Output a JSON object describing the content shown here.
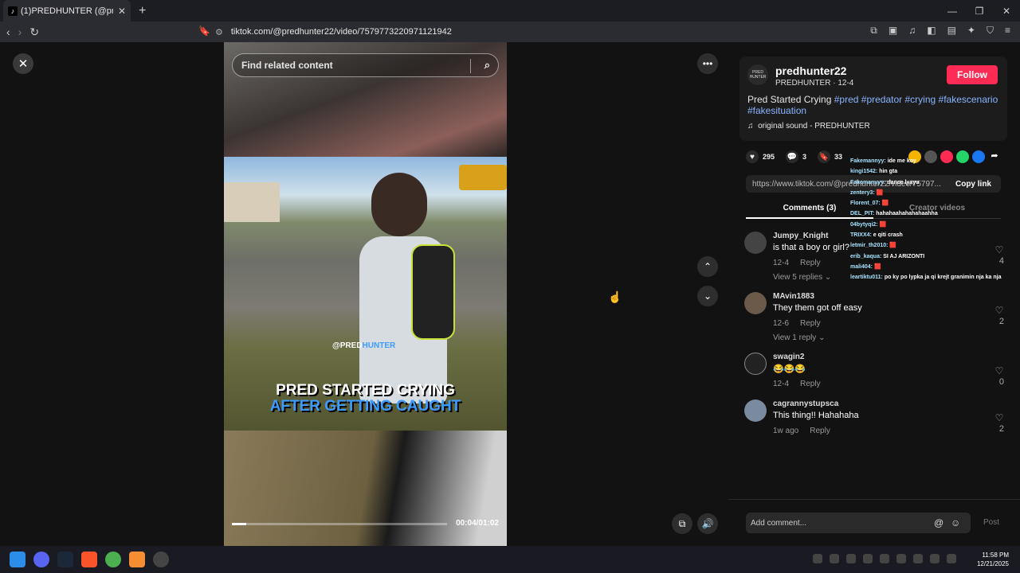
{
  "browser": {
    "tab_title": "(1)PREDHUNTER (@predhunt",
    "tab_favicon": "TikTok",
    "url": "tiktok.com/@predhunter22/video/7579773220971121942"
  },
  "player": {
    "search_placeholder": "Find related content",
    "time_display": "00:04/01:02",
    "progress_fraction": 0.065,
    "caption_line1": "PRED STARTED CRYING",
    "caption_line2": "AFTER GETTING CAUGHT",
    "watermark_prefix": "@PRED",
    "watermark_suffix": "HUNTER"
  },
  "author": {
    "username": "predhunter22",
    "nickname_date": "PREDHUNTER · 12-4",
    "follow_label": "Follow",
    "avatar_text": "PRED HUNTER",
    "description": "Pred Started Crying",
    "hashtags": [
      "#pred",
      "#predator",
      "#crying",
      "#fakescenario",
      "#fakesituation"
    ],
    "music": "original sound - PREDHUNTER"
  },
  "stats": {
    "likes": "295",
    "comments": "3",
    "saves": "33"
  },
  "link": {
    "url": "https://www.tiktok.com/@predhunter22/video/75797...",
    "copy_label": "Copy link"
  },
  "tabs": {
    "comments": "Comments (3)",
    "creator": "Creator videos"
  },
  "comments": [
    {
      "user": "Jumpy_Knight",
      "text": "is that a boy or girl?",
      "date": "12-4",
      "reply": "Reply",
      "likes": "4",
      "view_replies": "View 5 replies ⌄"
    },
    {
      "user": "MAvin1883",
      "text": "They them got off easy",
      "date": "12-6",
      "reply": "Reply",
      "likes": "2",
      "view_replies": "View 1 reply ⌄"
    },
    {
      "user": "swagin2",
      "text": "😂😂😂",
      "date": "12-4",
      "reply": "Reply",
      "likes": "0",
      "view_replies": ""
    },
    {
      "user": "cagrannystupsca",
      "text": "This thing!! Hahahaha",
      "date": "1w ago",
      "reply": "Reply",
      "likes": "2",
      "view_replies": ""
    }
  ],
  "chat_overlay": [
    {
      "name": "Fakemannyy:",
      "msg": "ide me koy"
    },
    {
      "name": "kingi1542:",
      "msg": "hin gta"
    },
    {
      "name": "Fakemanyyy:",
      "msg": "dance lyayu"
    },
    {
      "name": "zentery3:",
      "msg": "🟥"
    },
    {
      "name": "Florent_07:",
      "msg": "🟥"
    },
    {
      "name": "DEL_PIT:",
      "msg": "hahahaahahahahaahha"
    },
    {
      "name": "04bytyqi2:",
      "msg": "🟥"
    },
    {
      "name": "TRIXX4:",
      "msg": "e qiti crash"
    },
    {
      "name": "letmir_th2010:",
      "msg": "🟥"
    },
    {
      "name": "erib_kaqua:",
      "msg": "SI AJ ARIZONTI"
    },
    {
      "name": "mali404:",
      "msg": "🟥"
    },
    {
      "name": "leartiktu011:",
      "msg": "po ky po lypka ja qi krejt granimin nja ka nja"
    }
  ],
  "composer": {
    "placeholder": "Add comment...",
    "post_label": "Post"
  },
  "taskbar": {
    "time": "11:58 PM",
    "date": "12/21/2025"
  }
}
